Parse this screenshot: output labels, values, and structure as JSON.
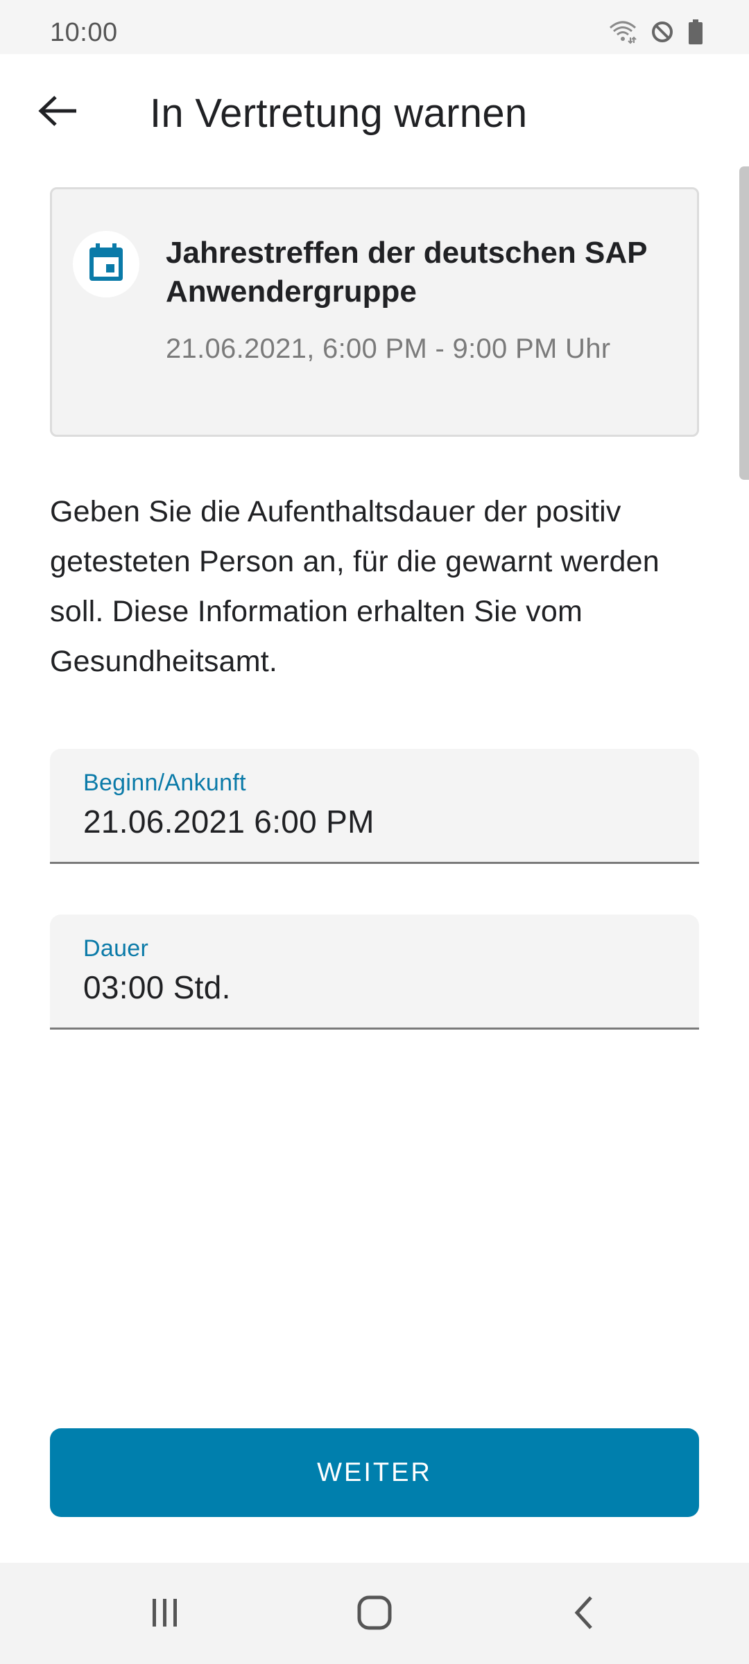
{
  "status_bar": {
    "time": "10:00",
    "icons": [
      "wifi-icon",
      "do-not-disturb-icon",
      "battery-icon"
    ]
  },
  "app_bar": {
    "back_icon": "arrow-left-icon",
    "title": "In Vertretung warnen"
  },
  "event": {
    "icon": "calendar-icon",
    "title": "Jahrestreffen der deutschen SAP Anwendergruppe",
    "time": "21.06.2021, 6:00 PM - 9:00 PM Uhr"
  },
  "description": "Geben Sie die Aufenthaltsdauer der positiv getesteten Person an, für die gewarnt werden soll. Diese Information erhalten Sie vom Gesundheitsamt.",
  "fields": {
    "begin": {
      "label": "Beginn/Ankunft",
      "value": "21.06.2021 6:00 PM"
    },
    "duration": {
      "label": "Dauer",
      "value": "03:00 Std."
    }
  },
  "primary_button": {
    "label": "WEITER"
  },
  "nav_bar": {
    "items": [
      "recents-icon",
      "home-icon",
      "back-icon"
    ]
  },
  "colors": {
    "accent": "#007fad",
    "label_accent": "#0a7aa8",
    "text_primary": "#202124",
    "text_secondary": "#7a7a7a",
    "card_background": "#f3f3f3"
  }
}
